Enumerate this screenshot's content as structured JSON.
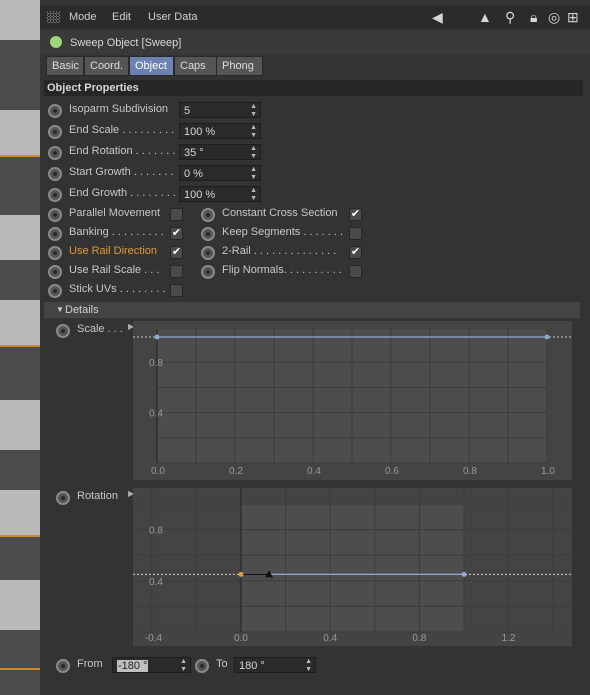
{
  "menubar": {
    "mode": "Mode",
    "edit": "Edit",
    "user_data": "User Data"
  },
  "object": {
    "title": "Sweep Object [Sweep]"
  },
  "tabs": [
    {
      "label": "Basic",
      "active": false
    },
    {
      "label": "Coord.",
      "active": false
    },
    {
      "label": "Object",
      "active": true
    },
    {
      "label": "Caps",
      "active": false
    },
    {
      "label": "Phong",
      "active": false
    }
  ],
  "section_title": "Object Properties",
  "fields": [
    {
      "label": "Isoparm Subdivision",
      "value": "5"
    },
    {
      "label": "End Scale . . . . . . . . .",
      "value": "100 %"
    },
    {
      "label": "End Rotation . . . . . . .",
      "value": "35 °"
    },
    {
      "label": "Start Growth . . . . . . .",
      "value": "0 %"
    },
    {
      "label": "End Growth . . . . . . . .",
      "value": "100 %"
    }
  ],
  "checkboxes_left": [
    {
      "label": "Parallel Movement",
      "checked": false
    },
    {
      "label": "Banking . . . . . . . . .",
      "checked": true
    },
    {
      "label": "Use Rail Direction",
      "checked": true,
      "highlight": "#e09a3a"
    },
    {
      "label": "Use Rail Scale . . .",
      "checked": false
    },
    {
      "label": "Stick UVs . . . . . . . .",
      "checked": false
    }
  ],
  "checkboxes_right": [
    {
      "label": "Constant Cross Section",
      "checked": true
    },
    {
      "label": "Keep Segments . . . . . . .",
      "checked": false
    },
    {
      "label": "2-Rail . . . . . . . . . . . . . .",
      "checked": true
    },
    {
      "label": "Flip Normals. . . . . . . . . .",
      "checked": false
    }
  ],
  "details_title": "Details",
  "scale_graph": {
    "label": "Scale . . .",
    "x_ticks": [
      "0.0",
      "0.2",
      "0.4",
      "0.6",
      "0.8",
      "1.0"
    ],
    "y_ticks": [
      "0.8",
      "0.4"
    ],
    "curve_value": 1.0
  },
  "rotation_graph": {
    "label": "Rotation",
    "x_ticks": [
      "-0.4",
      "0.0",
      "0.4",
      "0.8",
      "1.2"
    ],
    "y_ticks": [
      "0.8",
      "0.4"
    ],
    "curve_value": 0.45
  },
  "range": {
    "from_label": "From",
    "from_value": "-180 °",
    "to_label": "To",
    "to_value": "180 °"
  },
  "colors": {
    "accent_tab": "#6d82b0",
    "curve": "#8fa8d8",
    "highlight": "#e09a3a"
  }
}
